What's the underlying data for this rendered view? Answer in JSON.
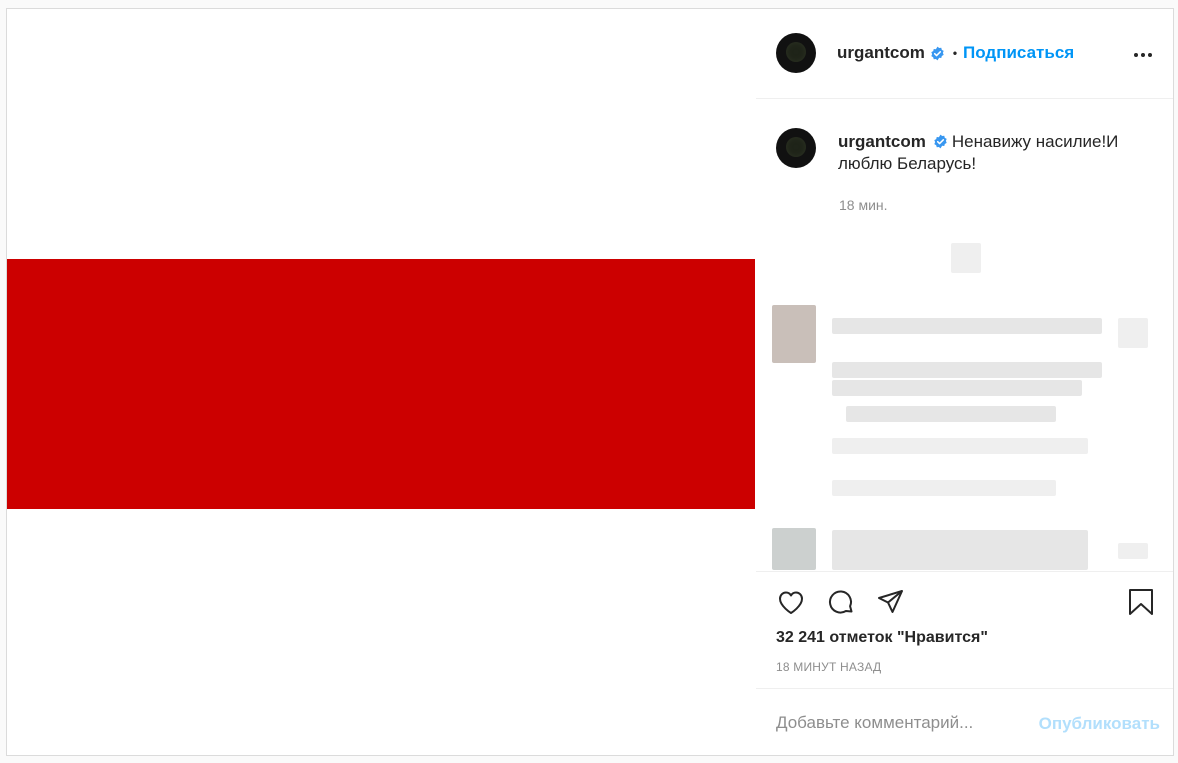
{
  "post": {
    "author": {
      "username": "urgantcom",
      "verified": true,
      "follow_label": "Подписаться",
      "separator": "•"
    },
    "media": {
      "description_colors": [
        "#ffffff",
        "#cc0000",
        "#ffffff"
      ]
    },
    "caption": {
      "username": "urgantcom",
      "text": "Ненавижу насилие!И люблю Беларусь!",
      "time": "18 мин."
    },
    "actions": {
      "like_icon": "heart-icon",
      "comment_icon": "comment-icon",
      "share_icon": "paper-plane-icon",
      "save_icon": "bookmark-icon"
    },
    "likes_text": "32 241 отметок \"Нравится\"",
    "time_ago": "18 МИНУТ НАЗАД",
    "comment_box": {
      "placeholder": "Добавьте комментарий...",
      "publish_label": "Опубликовать"
    }
  },
  "colors": {
    "accent": "#0095f6",
    "publish_disabled": "#b2dffc",
    "flag_red": "#cc0000",
    "text": "#262626",
    "muted": "#8e8e8e"
  }
}
